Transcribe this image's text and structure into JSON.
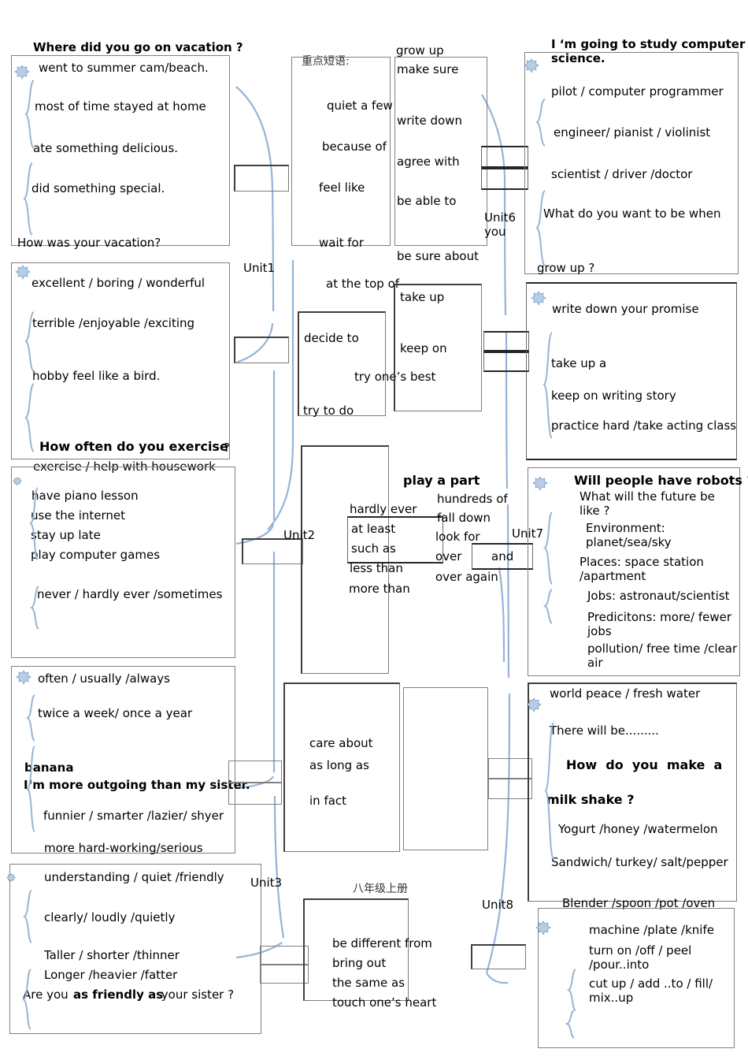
{
  "document": {
    "title_cn_top": "重点短语:",
    "title_cn_bottom": "八年级上册"
  },
  "units": [
    {
      "id": "unit1",
      "label": "Unit1"
    },
    {
      "id": "unit2",
      "label": "Unit2"
    },
    {
      "id": "unit3",
      "label": "Unit3"
    },
    {
      "id": "unit6",
      "label": "Unit6 you"
    },
    {
      "id": "unit7",
      "label": "Unit7"
    },
    {
      "id": "unit8",
      "label": "Unit8"
    }
  ],
  "left_column": [
    {
      "id": "vacation",
      "heading": "Where did you go on vacation ?",
      "lines": [
        "went to summer cam/beach.",
        "most of time stayed at home",
        "ate something delicious.",
        "did something special.",
        "How was your vacation?"
      ]
    },
    {
      "id": "adjectives",
      "lines": [
        "excellent / boring / wonderful",
        "terrible /enjoyable /exciting",
        "hobby feel like a bird.",
        "How often do you exercise",
        "?",
        "exercise / help with housework"
      ]
    },
    {
      "id": "activities",
      "lines": [
        "have piano lesson",
        "use the internet",
        "stay up late",
        "play computer games",
        "never / hardly ever /sometimes"
      ]
    },
    {
      "id": "frequency",
      "lines": [
        "often / usually /always",
        "twice a week/ once a year",
        "banana",
        "I‘m more outgoing than my sister.",
        "funnier / smarter /lazier/ shyer",
        "more hard-working/serious"
      ]
    },
    {
      "id": "comparatives",
      "lines": [
        "understanding / quiet /friendly",
        "clearly/ loudly /quietly",
        "Taller / shorter /thinner",
        "Longer /heavier /fatter",
        "Are you ",
        "as friendly as",
        " your sister ?"
      ]
    }
  ],
  "middle_column": [
    {
      "id": "phrases-1",
      "lines": [
        "quiet a few",
        "because of",
        "feel like",
        "wait for"
      ]
    },
    {
      "id": "phrases-2",
      "lines": [
        "grow up",
        "make sure",
        "write down",
        "agree with",
        "be able to",
        "be sure about"
      ]
    },
    {
      "id": "phrases-3",
      "lines": [
        "at the top of",
        "decide to",
        "try one’s best",
        "try to do"
      ]
    },
    {
      "id": "phrases-4",
      "lines": [
        "take up",
        "keep on"
      ]
    },
    {
      "id": "phrases-5",
      "lines": [
        "hardly ever",
        "at least",
        "such as",
        "less than",
        "more than"
      ]
    },
    {
      "id": "phrases-6",
      "lines": [
        "play a part",
        "hundreds of",
        "fall down",
        "look for",
        "over",
        "over again"
      ]
    },
    {
      "id": "phrases-7",
      "lines": [
        "care about",
        "as long as",
        "in fact"
      ]
    },
    {
      "id": "phrases-8",
      "lines": [
        "be different from",
        "bring out",
        "the same as",
        "touch one’s heart"
      ]
    },
    {
      "id": "connector-and",
      "lines": [
        "and"
      ]
    }
  ],
  "right_column": [
    {
      "id": "future-jobs",
      "heading": "I ‘m  going  to  study  computer  science.",
      "lines": [
        "pilot / computer programmer",
        "engineer/ pianist / violinist",
        "scientist / driver /doctor",
        "What do you want to be when",
        "grow up ?"
      ]
    },
    {
      "id": "promises",
      "lines": [
        "write down your promise",
        "take up a",
        "keep on writing story",
        "practice hard /take acting class"
      ]
    },
    {
      "id": "robots",
      "heading": "Will people have robots ?",
      "lines": [
        "What will the future be like ?",
        "Environment: planet/sea/sky",
        "Places: space station /apartment",
        "Jobs: astronaut/scientist",
        "Predicitons: more/ fewer jobs",
        "pollution/ free time /clear air"
      ]
    },
    {
      "id": "milkshake",
      "lines": [
        "world peace / fresh water",
        "There will be.........",
        "How  do  you  make  a",
        "milk shake ?",
        "Yogurt /honey /watermelon",
        "Sandwich/ turkey/ salt/pepper",
        "Blender /spoon /pot /oven"
      ]
    },
    {
      "id": "cooking",
      "lines": [
        "machine   /plate    /knife",
        "turn on /off     / peel /pour..into",
        "cut up / add ..to / fill/ mix..up"
      ]
    }
  ],
  "colors": {
    "brace": "#9ab4d4",
    "star_fill": "#b8cce4",
    "star_stroke": "#7ba0c8",
    "connector": "#95b3d7",
    "box_border": "#808080",
    "box_border_dark": "#3f3f3f"
  }
}
